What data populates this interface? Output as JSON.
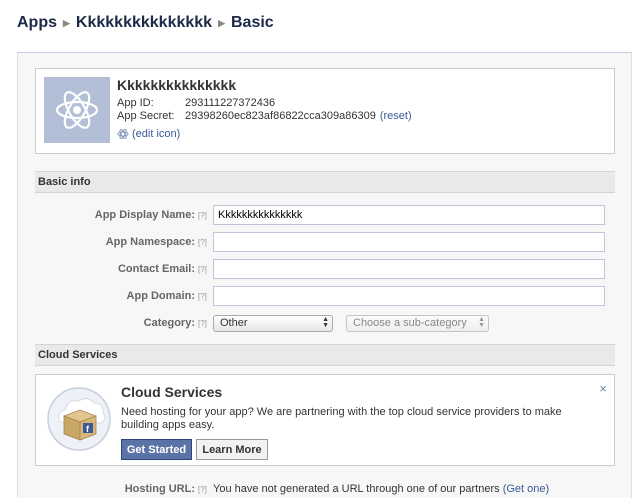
{
  "breadcrumb": {
    "root": "Apps",
    "app": "Kkkkkkkkkkkkkkk",
    "current": "Basic"
  },
  "app": {
    "name": "Kkkkkkkkkkkkkkk",
    "id_label": "App ID:",
    "id_value": "293111227372436",
    "secret_label": "App Secret:",
    "secret_value": "29398260ec823af86822cca309a86309",
    "reset_label": "(reset)",
    "edit_icon_label": "(edit icon)"
  },
  "basic_info": {
    "header": "Basic info",
    "help": "[?]",
    "fields": {
      "display_name": {
        "label": "App Display Name:",
        "value": "Kkkkkkkkkkkkkkk",
        "placeholder": ""
      },
      "namespace": {
        "label": "App Namespace:",
        "value": "",
        "placeholder": ""
      },
      "contact_email": {
        "label": "Contact Email:",
        "value": "",
        "placeholder": ""
      },
      "app_domain": {
        "label": "App Domain:",
        "value": "",
        "placeholder": ""
      }
    },
    "category": {
      "label": "Category:",
      "selected": "Other",
      "sub_selected": "Choose a sub-category"
    }
  },
  "cloud": {
    "header": "Cloud Services",
    "title": "Cloud Services",
    "description": "Need hosting for your app? We are partnering with the top cloud service providers to make building apps easy.",
    "get_started": "Get Started",
    "learn_more": "Learn More",
    "close": "×"
  },
  "hosting": {
    "label": "Hosting URL:",
    "help": "[?]",
    "text": "You have not generated a URL through one of our partners",
    "link": "(Get one)"
  },
  "colors": {
    "link": "#3b5998",
    "primary_button": "#5b74a8",
    "icon_bg": "#b3bfd6",
    "header_bg": "#e9e9e9"
  },
  "icons": [
    "atom-icon",
    "gear-icon",
    "close-icon",
    "cloud-box-icon",
    "facebook-icon",
    "chevron-right-icon",
    "select-arrows-icon"
  ]
}
